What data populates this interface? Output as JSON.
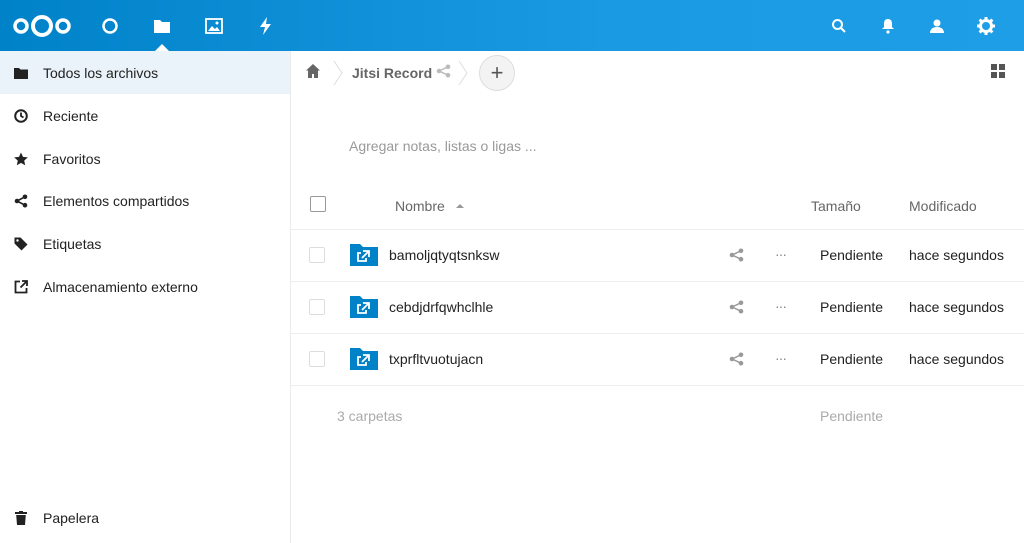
{
  "colors": {
    "header_bg": "#0082c9",
    "sidebar_active": "#e9f3f9",
    "folder_blue": "#0082c9"
  },
  "header": {
    "logo": "nextcloud-logo",
    "apps": [
      {
        "icon": "circle-icon",
        "name": "dashboard"
      },
      {
        "icon": "folder-icon",
        "name": "files",
        "active": true
      },
      {
        "icon": "image-icon",
        "name": "photos"
      },
      {
        "icon": "lightning-icon",
        "name": "activity"
      }
    ],
    "right": [
      "search-icon",
      "bell-icon",
      "contacts-icon",
      "gear-icon"
    ]
  },
  "sidebar": {
    "items": [
      {
        "label": "Todos los archivos",
        "icon": "folder-icon",
        "active": true
      },
      {
        "label": "Reciente",
        "icon": "clock-icon"
      },
      {
        "label": "Favoritos",
        "icon": "star-icon"
      },
      {
        "label": "Elementos compartidos",
        "icon": "share-icon"
      },
      {
        "label": "Etiquetas",
        "icon": "tag-icon"
      },
      {
        "label": "Almacenamiento externo",
        "icon": "external-icon"
      }
    ],
    "trash": {
      "label": "Papelera",
      "icon": "trash-icon"
    }
  },
  "breadcrumb": {
    "home": "home-icon",
    "current": "Jitsi Record",
    "add": "+"
  },
  "notes_placeholder": "Agregar notas, listas o ligas ...",
  "table": {
    "columns": {
      "name": "Nombre",
      "size": "Tamaño",
      "modified": "Modificado"
    },
    "rows": [
      {
        "name": "bamoljqtyqtsnksw",
        "size": "Pendiente",
        "modified": "hace segundos"
      },
      {
        "name": "cebdjdrfqwhclhle",
        "size": "Pendiente",
        "modified": "hace segundos"
      },
      {
        "name": "txprfltvuotujacn",
        "size": "Pendiente",
        "modified": "hace segundos"
      }
    ],
    "more": "···",
    "summary": {
      "count": "3 carpetas",
      "size": "Pendiente"
    }
  }
}
